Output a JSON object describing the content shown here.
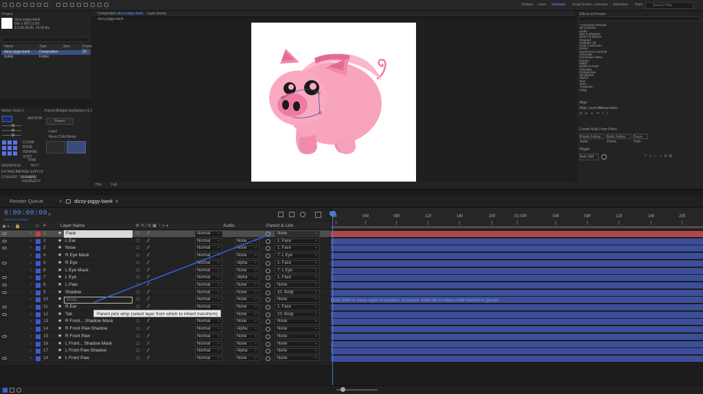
{
  "workspace": {
    "tabs": [
      "Default",
      "Learn",
      "Standard",
      "Small Screen",
      "Libraries",
      "Animation",
      "Paint"
    ],
    "search_placeholder": "Search Help"
  },
  "project": {
    "title": "Project",
    "footage_name": "dizzy-piggy-bank",
    "footage_meta_1": "800 x 500 (1.00)",
    "footage_meta_2": "Δ 0;00;06;00, 24.00 fps",
    "columns": [
      "Name",
      "Type",
      "Size",
      "Frame Rate"
    ],
    "items": [
      {
        "name": "dizzy-piggy-bank",
        "type": "Composition",
        "rate": "24"
      },
      {
        "name": "Solids",
        "type": "Folder",
        "rate": ""
      }
    ]
  },
  "motion_tools": {
    "title": "Motion Tools 2",
    "labels": [
      "ANCHOR",
      "CLONE",
      "BONE",
      "RENAME",
      "SORT",
      "TRIM",
      "SEQUENCE",
      "TEXT",
      "EXTRACT",
      "MERGE",
      "EXPLODE",
      "CONVERT TO SHAPE",
      "REMOVE PROPERTY"
    ]
  },
  "duik": {
    "title": "Parent Multiple Keyframes v1.0 AE",
    "button": "Parent",
    "fields": [
      "Layer",
      "Move Child Below"
    ]
  },
  "composition": {
    "tab_label": "Composition",
    "comp_name": "dizzy-piggy-bank",
    "sub_tab": "dizzy-piggy-bank",
    "layer_tab": "Layer (none)",
    "zoom": "70%",
    "quality": "Full"
  },
  "effects": {
    "title": "Effects & Presets",
    "items": [
      "* Animation Presets",
      "3D Channel",
      "Audio",
      "Blur & Sharpen",
      "Boris FX Mocha",
      "Channel",
      "CINEMA 4D",
      "Color Correction",
      "Distort",
      "Expression Controls",
      "Generate",
      "Immersive Video",
      "Keying",
      "Matte",
      "Noise & Grain",
      "Obsolete",
      "Perspective",
      "Simulation",
      "Stylize",
      "Text",
      "Time",
      "Transition",
      "Utility"
    ],
    "align_title": "Align",
    "align_to": "Align Layers to:",
    "align_value": "Composition",
    "create_title": "Create Nulls From Paths",
    "create_buttons": [
      "Points Follow Nulls",
      "Nulls Follow Points",
      "Trace Path"
    ],
    "wiggle_title": "Wiggle",
    "wiggle_button": "Auto Still"
  },
  "timeline": {
    "render_queue": "Render Queue",
    "comp_tab": "dizzy-piggy-bank",
    "timecode": "0:00:00:00",
    "frames": "00000 (24.00 fps)",
    "search_placeholder": "",
    "ruler": [
      "0f",
      "04f",
      "08f",
      "12f",
      "16f",
      "20f",
      "01:00f",
      "04f",
      "08f",
      "12f",
      "16f",
      "20f"
    ],
    "headers": {
      "hash": "#",
      "layer_name": "Layer Name",
      "audio": "Audio",
      "parent": "Parent & Link"
    },
    "hint": "Hold Shift to move layer to location of parent. Hold Alt to retain child transform (jump)",
    "tooltip": "Parent pick whip (select layer from which to inherit transform)",
    "layers": [
      {
        "num": "1",
        "name": "Face",
        "mode": "Normal",
        "track": "",
        "parent": "None",
        "label": "#d63b3b"
      },
      {
        "num": "2",
        "name": "L Ear",
        "mode": "Normal",
        "track": "None",
        "parent": "1. Face",
        "label": "#3a5bd6"
      },
      {
        "num": "3",
        "name": "Nose",
        "mode": "Normal",
        "track": "None",
        "parent": "1. Face",
        "label": "#3a5bd6"
      },
      {
        "num": "4",
        "name": "R Eye Mask",
        "mode": "Normal",
        "track": "None",
        "parent": "7. L Eye",
        "label": "#3a5bd6"
      },
      {
        "num": "5",
        "name": "R Eye",
        "mode": "Normal",
        "track": "Alpha",
        "parent": "1. Face",
        "label": "#3a5bd6"
      },
      {
        "num": "6",
        "name": "L Eye Mask",
        "mode": "Normal",
        "track": "None",
        "parent": "7. L Eye",
        "label": "#3a5bd6"
      },
      {
        "num": "7",
        "name": "L Eye",
        "mode": "Normal",
        "track": "Alpha",
        "parent": "1. Face",
        "label": "#3a5bd6"
      },
      {
        "num": "8",
        "name": "L Paw",
        "mode": "Normal",
        "track": "None",
        "parent": "None",
        "label": "#3a5bd6"
      },
      {
        "num": "9",
        "name": "Shadow",
        "mode": "Normal",
        "track": "None",
        "parent": "10. Body",
        "label": "#3a5bd6"
      },
      {
        "num": "10",
        "name": "Body",
        "mode": "Normal",
        "track": "None",
        "parent": "None",
        "label": "#3a5bd6"
      },
      {
        "num": "11",
        "name": "R Ear",
        "mode": "Normal",
        "track": "None",
        "parent": "1. Face",
        "label": "#3a5bd6"
      },
      {
        "num": "12",
        "name": "Tail",
        "mode": "Normal",
        "track": "None",
        "parent": "10. Body",
        "label": "#3a5bd6"
      },
      {
        "num": "13",
        "name": "R Front... Shadow Mask",
        "mode": "Normal",
        "track": "None",
        "parent": "None",
        "label": "#3a5bd6"
      },
      {
        "num": "14",
        "name": "R Front Paw Shadow",
        "mode": "Normal",
        "track": "Alpha",
        "parent": "None",
        "label": "#3a5bd6"
      },
      {
        "num": "15",
        "name": "R Front Paw",
        "mode": "Normal",
        "track": "None",
        "parent": "None",
        "label": "#3a5bd6"
      },
      {
        "num": "16",
        "name": "L Front... Shadow Mask",
        "mode": "Normal",
        "track": "None",
        "parent": "None",
        "label": "#3a5bd6"
      },
      {
        "num": "17",
        "name": "L Front Paw Shadow",
        "mode": "Normal",
        "track": "Alpha",
        "parent": "None",
        "label": "#3a5bd6"
      },
      {
        "num": "18",
        "name": "L Front Paw",
        "mode": "Normal",
        "track": "None",
        "parent": "None",
        "label": "#3a5bd6"
      }
    ]
  },
  "colors": {
    "accent": "#4d8cff",
    "track_blue": "#3d4f9a",
    "track_red": "#b04848",
    "pig_pink": "#f4a0b8",
    "pig_dark": "#e0708f"
  }
}
